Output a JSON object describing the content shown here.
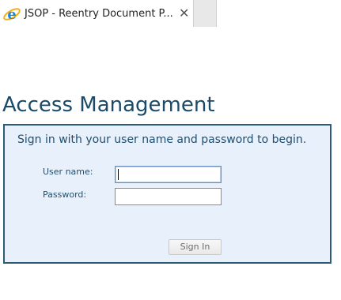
{
  "browser": {
    "tab_title": "JSOP - Reentry Document P...",
    "close_glyph": "✕",
    "tab_icon": "internet-explorer-icon"
  },
  "page": {
    "title": "Access Management"
  },
  "login": {
    "intro": "Sign in with your user name and password to begin.",
    "username_label": "User name:",
    "username_value": "",
    "password_label": "Password:",
    "password_value": "",
    "signin_label": "Sign In"
  },
  "colors": {
    "title": "#1b4a68",
    "box_border": "#2d5b73",
    "box_background": "#e8f0fc"
  }
}
